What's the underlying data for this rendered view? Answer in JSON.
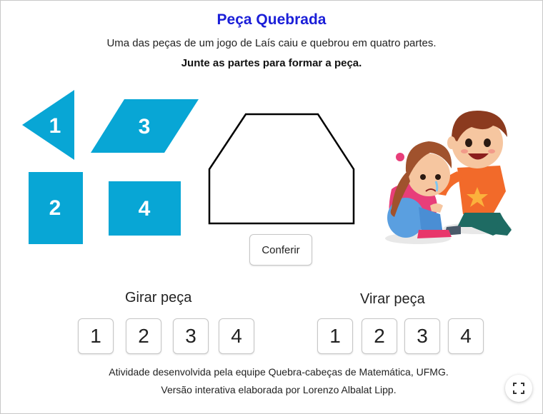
{
  "header": {
    "title": "Peça Quebrada",
    "description": "Uma das peças de um jogo de Laís caiu e quebrou em quatro partes.",
    "instruction": "Junte as partes para formar a peça."
  },
  "pieces": [
    {
      "label": "1",
      "shape": "triangle"
    },
    {
      "label": "3",
      "shape": "parallelogram"
    },
    {
      "label": "2",
      "shape": "rectangle"
    },
    {
      "label": "4",
      "shape": "rectangle"
    }
  ],
  "colors": {
    "piece": "#08a6d5",
    "title": "#1a1ed8"
  },
  "target": {
    "shape": "hexagon-outline"
  },
  "check_button": {
    "label": "Conferir"
  },
  "rotate": {
    "label": "Girar peça",
    "buttons": [
      "1",
      "2",
      "3",
      "4"
    ]
  },
  "flip": {
    "label": "Virar peça",
    "buttons": [
      "1",
      "2",
      "3",
      "4"
    ]
  },
  "footer": {
    "line1": "Atividade desenvolvida pela equipe Quebra-cabeças de Matemática, UFMG.",
    "line2": "Versão interativa elaborada por Lorenzo Albalat Lipp."
  },
  "illustration": {
    "subject": "two-children-boy-comforting-crying-girl"
  },
  "fullscreen": {
    "icon": "fullscreen-icon"
  }
}
